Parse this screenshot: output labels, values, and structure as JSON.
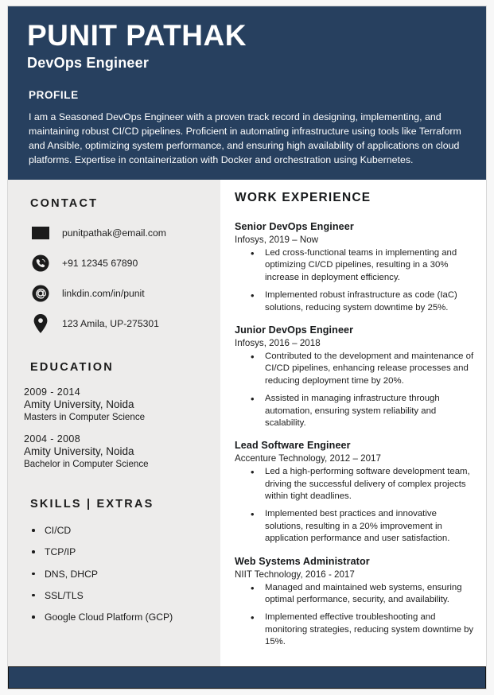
{
  "header": {
    "name": "PUNIT PATHAK",
    "job_title": "DevOps Engineer",
    "profile_label": "PROFILE",
    "profile_text": "I am a Seasoned DevOps Engineer with a proven track record in designing, implementing, and maintaining robust CI/CD pipelines. Proficient in automating infrastructure using tools like Terraform and Ansible, optimizing system performance, and ensuring high availability of applications on cloud platforms. Expertise in containerization with Docker and orchestration using Kubernetes.",
    "background_color": "#27405f"
  },
  "sidebar": {
    "contact": {
      "heading": "CONTACT",
      "items": [
        {
          "icon": "envelope-icon",
          "value": "punitpathak@email.com"
        },
        {
          "icon": "phone-icon",
          "value": "+91 12345 67890"
        },
        {
          "icon": "at-sign-icon",
          "value": "linkdin.com/in/punit"
        },
        {
          "icon": "location-pin-icon",
          "value": "123 Amila, UP-275301"
        }
      ]
    },
    "education": {
      "heading": "EDUCATION",
      "items": [
        {
          "years": "2009 - 2014",
          "school": "Amity University, Noida",
          "degree": "Masters in Computer Science"
        },
        {
          "years": "2004 - 2008",
          "school": "Amity University, Noida",
          "degree": "Bachelor in Computer Science"
        }
      ]
    },
    "skills": {
      "heading": "SKILLS | EXTRAS",
      "items": [
        "CI/CD",
        "TCP/IP",
        "DNS, DHCP",
        "SSL/TLS",
        "Google Cloud Platform (GCP)"
      ]
    },
    "background_color": "#edeceb"
  },
  "main": {
    "heading": "WORK EXPERIENCE",
    "jobs": [
      {
        "title": "Senior DevOps Engineer",
        "meta": "Infosys, 2019 – Now",
        "bullets": [
          "Led cross-functional teams in implementing and optimizing CI/CD pipelines, resulting in a 30% increase in deployment efficiency.",
          " Implemented robust infrastructure as code (IaC) solutions, reducing system downtime by 25%."
        ]
      },
      {
        "title": "Junior DevOps Engineer",
        "meta": "Infosys, 2016 – 2018",
        "bullets": [
          "Contributed to the development and maintenance of CI/CD pipelines, enhancing release processes and reducing deployment time by 20%.",
          " Assisted in managing infrastructure through automation, ensuring system reliability and scalability."
        ]
      },
      {
        "title": "Lead Software Engineer",
        "meta": "Accenture Technology, 2012 – 2017",
        "bullets": [
          "Led a high-performing software development team, driving the successful delivery of complex projects within tight deadlines.",
          "Implemented best practices and innovative solutions, resulting in a 20% improvement in application performance and user satisfaction."
        ]
      },
      {
        "title": "Web Systems Administrator",
        "meta": "NIIT Technology, 2016 - 2017",
        "bullets": [
          "Managed and maintained web systems, ensuring optimal performance, security, and availability.",
          " Implemented effective troubleshooting and monitoring strategies, reducing system downtime by 15%."
        ]
      }
    ]
  },
  "footer": {
    "background_color": "#27405f"
  }
}
